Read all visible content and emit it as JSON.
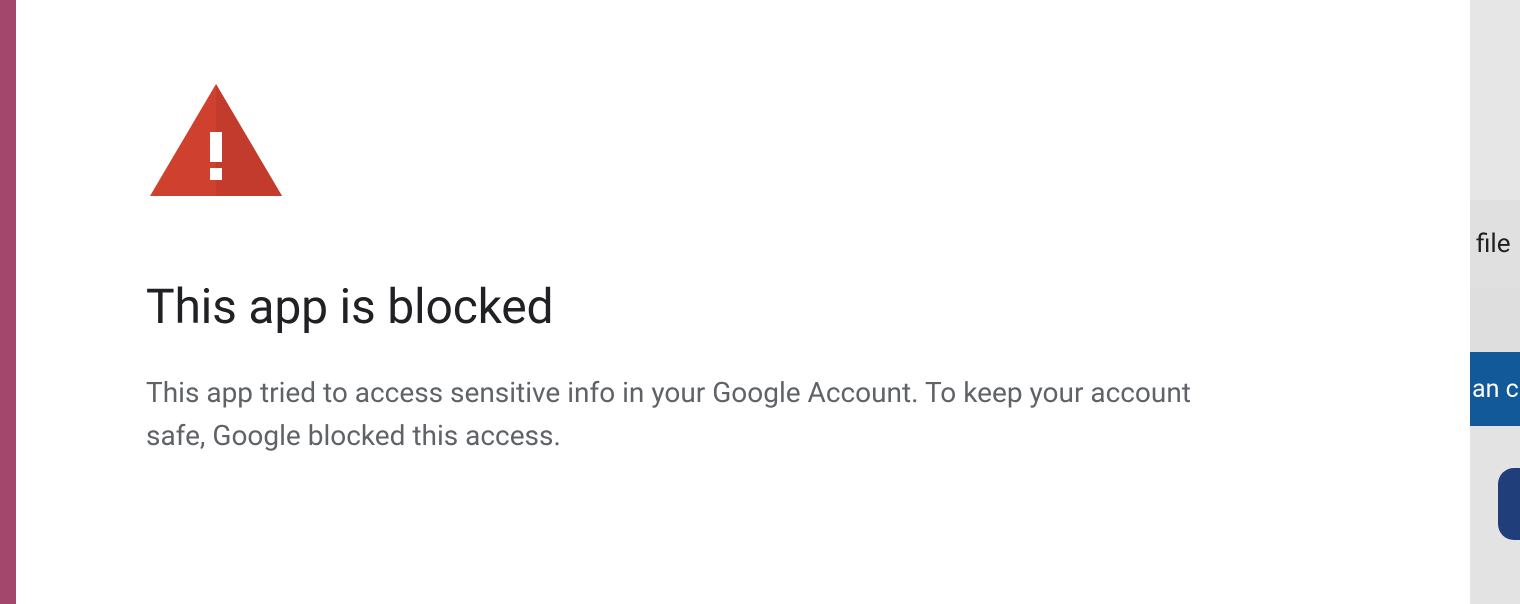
{
  "dialog": {
    "icon": "warning-triangle-icon",
    "heading": "This app is blocked",
    "description": "This app tried to access sensitive info in your Google Account. To keep your account safe, Google blocked this access."
  },
  "background": {
    "file_label": "file",
    "blue_label": "an c"
  },
  "colors": {
    "stripe": "#a3476d",
    "warning": "#d0402f",
    "heading": "#202124",
    "body": "#5f6368",
    "blue_row": "#12599a",
    "pill": "#1f3e7a"
  }
}
